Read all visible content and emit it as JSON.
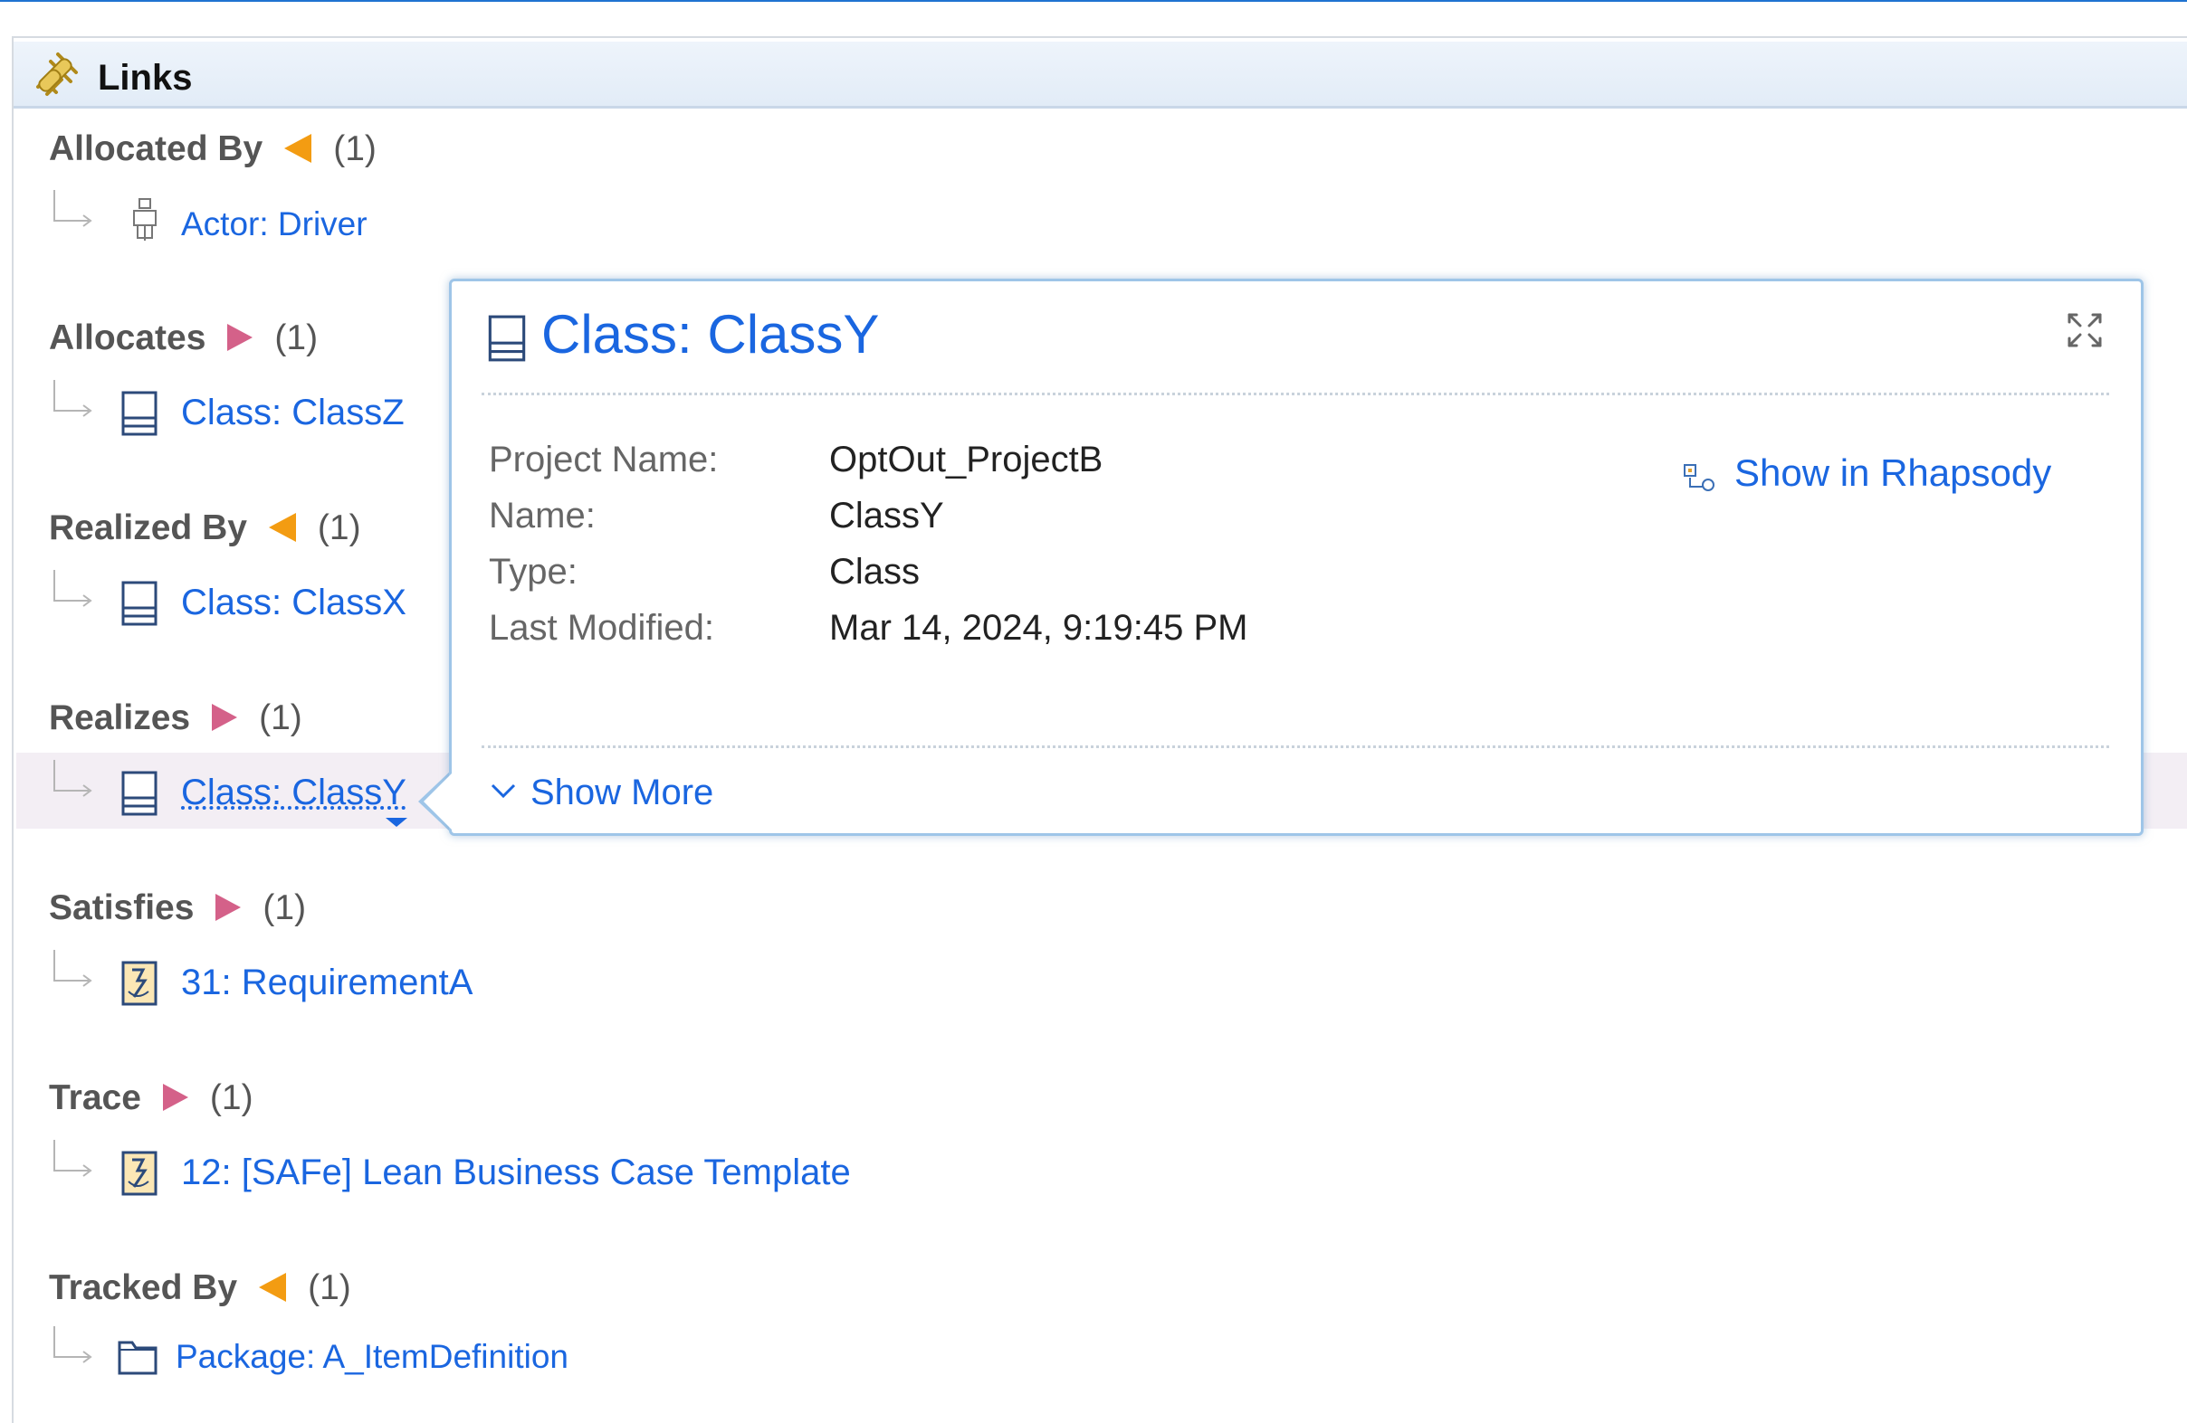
{
  "panel": {
    "title": "Links"
  },
  "sections": [
    {
      "title": "Allocated By",
      "direction": "incoming",
      "count": "(1)",
      "item": {
        "label": "Actor: Driver",
        "icon": "actor-icon"
      }
    },
    {
      "title": "Allocates",
      "direction": "outgoing",
      "count": "(1)",
      "item": {
        "label": "Class: ClassZ",
        "icon": "class-icon"
      }
    },
    {
      "title": "Realized By",
      "direction": "incoming",
      "count": "(1)",
      "item": {
        "label": "Class: ClassX",
        "icon": "class-icon"
      }
    },
    {
      "title": "Realizes",
      "direction": "outgoing",
      "count": "(1)",
      "item": {
        "label": "Class: ClassY",
        "icon": "class-icon",
        "selected": true
      }
    },
    {
      "title": "Satisfies",
      "direction": "outgoing",
      "count": "(1)",
      "item": {
        "label": "31: RequirementA",
        "icon": "requirement-icon"
      }
    },
    {
      "title": "Trace",
      "direction": "outgoing",
      "count": "(1)",
      "item": {
        "label": "12: [SAFe] Lean Business Case Template",
        "icon": "requirement-icon"
      }
    },
    {
      "title": "Tracked By",
      "direction": "incoming",
      "count": "(1)",
      "item": {
        "label": "Package: A_ItemDefinition",
        "icon": "package-icon"
      }
    }
  ],
  "popup": {
    "title": "Class: ClassY",
    "properties": [
      {
        "label": "Project Name:",
        "value": "OptOut_ProjectB"
      },
      {
        "label": "Name:",
        "value": "ClassY"
      },
      {
        "label": "Type:",
        "value": "Class"
      },
      {
        "label": "Last Modified:",
        "value": "Mar 14, 2024, 9:19:45 PM"
      }
    ],
    "show_in_label": "Show in Rhapsody",
    "show_more_label": "Show More"
  },
  "colors": {
    "link": "#1a66e0",
    "incoming_arrow": "#f39c12",
    "outgoing_arrow": "#d46189"
  }
}
